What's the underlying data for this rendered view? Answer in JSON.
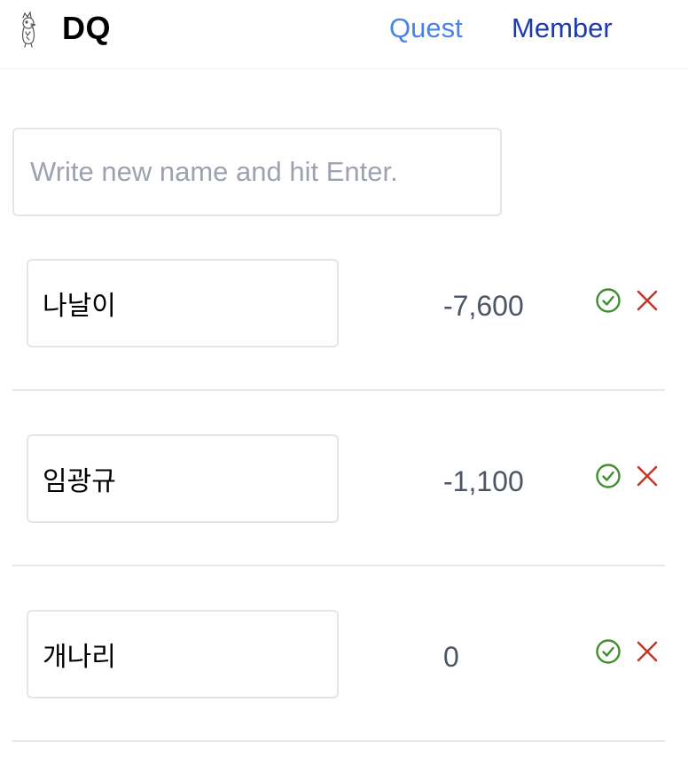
{
  "header": {
    "logo_icon": "bird-mascot-icon",
    "brand": "DQ",
    "nav": [
      {
        "label": "Quest",
        "color": "#4a83e8"
      },
      {
        "label": "Member",
        "color": "#1e3aa8"
      }
    ]
  },
  "new_member": {
    "placeholder": "Write new name and hit Enter.",
    "value": ""
  },
  "members": [
    {
      "name": "나날이",
      "balance": "-7,600"
    },
    {
      "name": "임광규",
      "balance": "-1,100"
    },
    {
      "name": "개나리",
      "balance": "0"
    }
  ],
  "actions": {
    "confirm_icon": "check-circle-icon",
    "confirm_color": "#3f8f2f",
    "delete_icon": "close-x-icon",
    "delete_color": "#c0392b"
  }
}
